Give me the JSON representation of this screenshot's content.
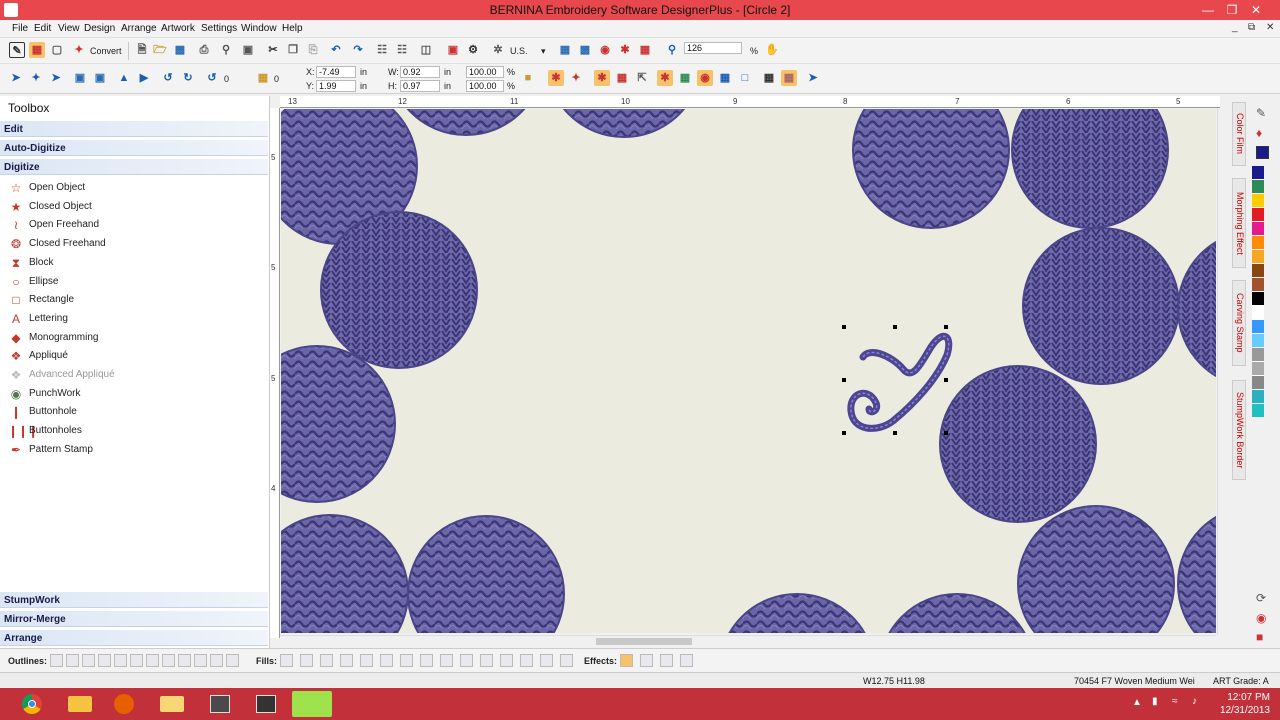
{
  "window": {
    "title": "BERNINA Embroidery Software DesignerPlus - [Circle 2]",
    "minimize": "—",
    "restore": "❐",
    "close": "✕"
  },
  "menu": [
    "File",
    "Edit",
    "View",
    "Design",
    "Arrange",
    "Artwork",
    "Settings",
    "Window",
    "Help"
  ],
  "toolbar1": {
    "convert_label": "Convert",
    "units": "U.S.",
    "zoom": "126",
    "zoom_unit": "%"
  },
  "toolbar2": {
    "angle": "0",
    "x_label": "X:",
    "x_value": "-7.49",
    "y_label": "Y:",
    "y_value": "1.99",
    "w_label": "W:",
    "w_value": "0.92",
    "h_label": "H:",
    "h_value": "0.97",
    "unit_in": "in",
    "scale_w": "100.00",
    "scale_h": "100.00",
    "percent": "%"
  },
  "toolbox": {
    "title": "Toolbox",
    "sections_top": [
      "Edit",
      "Auto-Digitize",
      "Digitize"
    ],
    "tools": [
      {
        "label": "Open Object",
        "icon": "star-outline-icon",
        "glyph": "☆",
        "color": "#c0392b"
      },
      {
        "label": "Closed Object",
        "icon": "star-filled-icon",
        "glyph": "★",
        "color": "#c0392b"
      },
      {
        "label": "Open Freehand",
        "icon": "freehand-open-icon",
        "glyph": "≀",
        "color": "#c0392b"
      },
      {
        "label": "Closed Freehand",
        "icon": "freehand-closed-icon",
        "glyph": "❂",
        "color": "#c0392b"
      },
      {
        "label": "Block",
        "icon": "block-icon",
        "glyph": "⧗",
        "color": "#c0392b"
      },
      {
        "label": "Ellipse",
        "icon": "ellipse-icon",
        "glyph": "○",
        "color": "#c0392b"
      },
      {
        "label": "Rectangle",
        "icon": "rectangle-icon",
        "glyph": "□",
        "color": "#c0392b"
      },
      {
        "label": "Lettering",
        "icon": "lettering-icon",
        "glyph": "A",
        "color": "#c0392b"
      },
      {
        "label": "Monogramming",
        "icon": "monogram-icon",
        "glyph": "◆",
        "color": "#c0392b"
      },
      {
        "label": "Appliqué",
        "icon": "applique-icon",
        "glyph": "❖",
        "color": "#c0392b"
      },
      {
        "label": "Advanced Appliqué",
        "icon": "advanced-applique-icon",
        "glyph": "❖",
        "color": "#bbbbbb",
        "disabled": true
      },
      {
        "label": "PunchWork",
        "icon": "punchwork-icon",
        "glyph": "◉",
        "color": "#557755"
      },
      {
        "label": "Buttonhole",
        "icon": "buttonhole-icon",
        "glyph": "❙",
        "color": "#c0392b"
      },
      {
        "label": "Buttonholes",
        "icon": "buttonholes-icon",
        "glyph": "❙❙❙",
        "color": "#c0392b"
      },
      {
        "label": "Pattern Stamp",
        "icon": "pattern-stamp-icon",
        "glyph": "✒",
        "color": "#c0392b"
      }
    ],
    "sections_bottom": [
      "StumpWork",
      "Mirror-Merge",
      "Arrange"
    ]
  },
  "rulers": {
    "h": [
      "13",
      "12",
      "11",
      "10",
      "9",
      "8",
      "7",
      "6",
      "5"
    ],
    "v": [
      "5",
      "5",
      "5",
      "4"
    ]
  },
  "right_dock": {
    "tabs": [
      "Color Film",
      "Morphing Effect",
      "Carving Stamp",
      "StumpWork Border"
    ],
    "palette": [
      "#1a1a8c",
      "#2e8b57",
      "#ffcc00",
      "#e31b23",
      "#e31b8c",
      "#ff8c00",
      "#f5a623",
      "#8b4513",
      "#a0522d",
      "#000000",
      "#ffffff",
      "#3399ff",
      "#66ccff",
      "#999999",
      "#aaaaaa",
      "#888888",
      "#2ab0c0",
      "#20c0c0"
    ]
  },
  "bottom_bar": {
    "outlines_label": "Outlines:",
    "fills_label": "Fills:",
    "effects_label": "Effects:"
  },
  "status": {
    "size": "W12.75 H11.98",
    "thread": "70454 F7 Woven Medium Wei",
    "grade": "ART Grade: A"
  },
  "taskbar": {
    "apps": [
      "chrome-icon",
      "file-explorer-icon",
      "firefox-icon",
      "folder-icon",
      "embroidery-app-icon",
      "bernina-icon",
      "designer-icon"
    ],
    "time": "12:07 PM",
    "date": "12/31/2013"
  }
}
